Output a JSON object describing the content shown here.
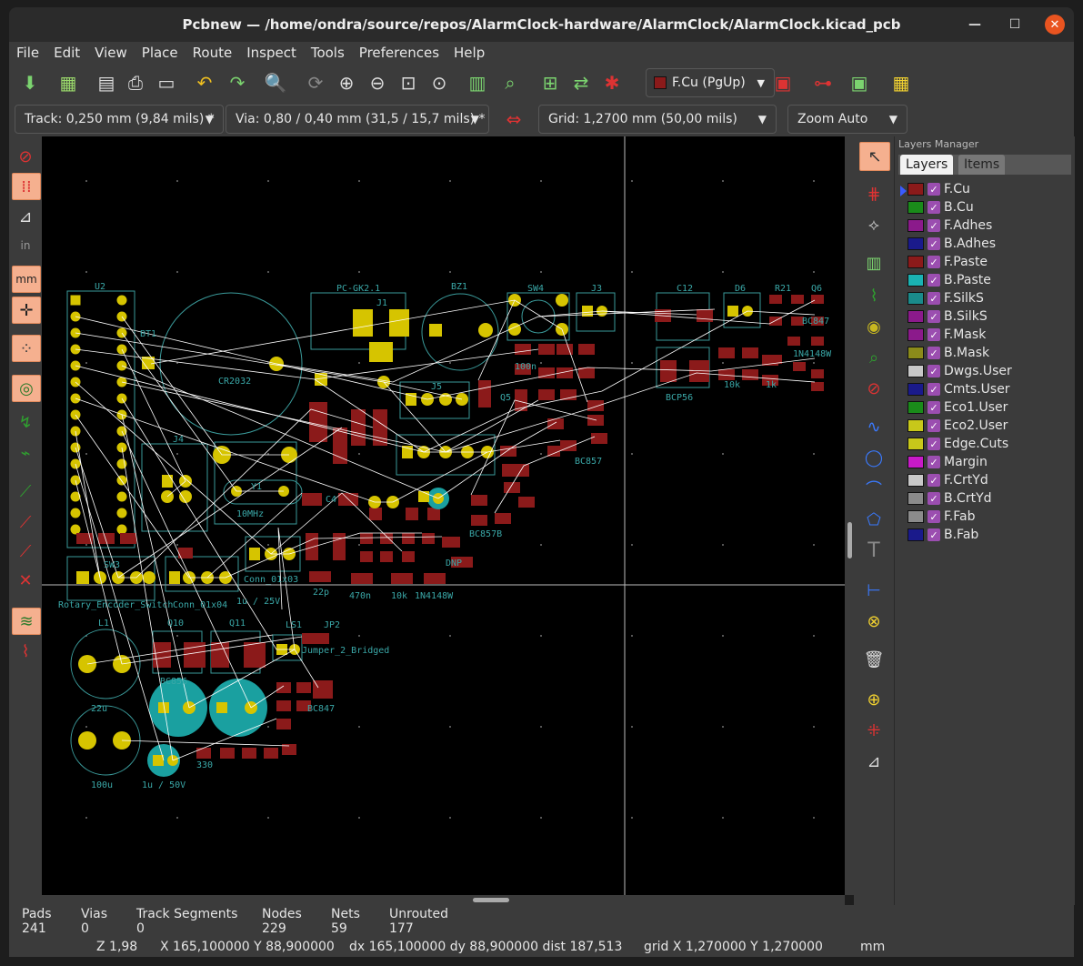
{
  "window": {
    "title": "Pcbnew — /home/ondra/source/repos/AlarmClock-hardware/AlarmClock/AlarmClock.kicad_pcb"
  },
  "menu": [
    "File",
    "Edit",
    "View",
    "Place",
    "Route",
    "Inspect",
    "Tools",
    "Preferences",
    "Help"
  ],
  "toolbar": {
    "active_layer": "F.Cu (PgUp)",
    "active_layer_color": "#8b1a1a"
  },
  "toolbar2": {
    "track": "Track: 0,250 mm (9,84 mils) *",
    "via": "Via: 0,80 / 0,40 mm (31,5 / 15,7 mils) *",
    "grid": "Grid: 1,2700 mm (50,00 mils)",
    "zoom": "Zoom Auto"
  },
  "layers_manager": {
    "title": "Layers Manager",
    "tabs": [
      "Layers",
      "Items"
    ],
    "layers": [
      {
        "name": "F.Cu",
        "color": "#8b1a1a"
      },
      {
        "name": "B.Cu",
        "color": "#1a8b1a"
      },
      {
        "name": "F.Adhes",
        "color": "#8b1a8b"
      },
      {
        "name": "B.Adhes",
        "color": "#1a1a8b"
      },
      {
        "name": "F.Paste",
        "color": "#8b1a1a"
      },
      {
        "name": "B.Paste",
        "color": "#1ab3b3"
      },
      {
        "name": "F.SilkS",
        "color": "#1a8b8b"
      },
      {
        "name": "B.SilkS",
        "color": "#8b1a8b"
      },
      {
        "name": "F.Mask",
        "color": "#8b1a8b"
      },
      {
        "name": "B.Mask",
        "color": "#8b8b1a"
      },
      {
        "name": "Dwgs.User",
        "color": "#c8c8c8"
      },
      {
        "name": "Cmts.User",
        "color": "#1a1a8b"
      },
      {
        "name": "Eco1.User",
        "color": "#1a8b1a"
      },
      {
        "name": "Eco2.User",
        "color": "#c8c81a"
      },
      {
        "name": "Edge.Cuts",
        "color": "#c8c81a"
      },
      {
        "name": "Margin",
        "color": "#c81ac8"
      },
      {
        "name": "F.CrtYd",
        "color": "#c8c8c8"
      },
      {
        "name": "B.CrtYd",
        "color": "#8b8b8b"
      },
      {
        "name": "F.Fab",
        "color": "#8b8b8b"
      },
      {
        "name": "B.Fab",
        "color": "#1a1a8b"
      }
    ]
  },
  "status": {
    "pads_label": "Pads",
    "pads": "241",
    "vias_label": "Vias",
    "vias": "0",
    "tracks_label": "Track Segments",
    "tracks": "0",
    "nodes_label": "Nodes",
    "nodes": "229",
    "nets_label": "Nets",
    "nets": "59",
    "unrouted_label": "Unrouted",
    "unrouted": "177",
    "zoom": "Z 1,98",
    "xy": "X 165,100000  Y 88,900000",
    "dxy": "dx 165,100000  dy 88,900000  dist 187,513",
    "grid": "grid X 1,270000  Y 1,270000",
    "units": "mm"
  },
  "board_labels": [
    "U2",
    "BT1",
    "CR2032",
    "J1",
    "PC-GK2.1",
    "BZ1",
    "SW4",
    "J3",
    "C12",
    "D6",
    "R21",
    "Q6",
    "BC847",
    "1N4148W",
    "BCP56",
    "10k",
    "1k",
    "J5",
    "Q5",
    "BC857",
    "J4",
    "Y1",
    "10MHz",
    "C4",
    "22p",
    "470n",
    "10k",
    "1N4148W",
    "Conn_01x03",
    "1u / 25V",
    "SW3",
    "Rotary_Encoder_Switch",
    "Conn_01x04",
    "L1",
    "Q10",
    "Q11",
    "LS1",
    "JP2",
    "Jumper_2_Bridged",
    "BC856",
    "BC847",
    "100u",
    "22u",
    "1u / 50V",
    "330",
    "DNP",
    "BC857B",
    "100n"
  ]
}
